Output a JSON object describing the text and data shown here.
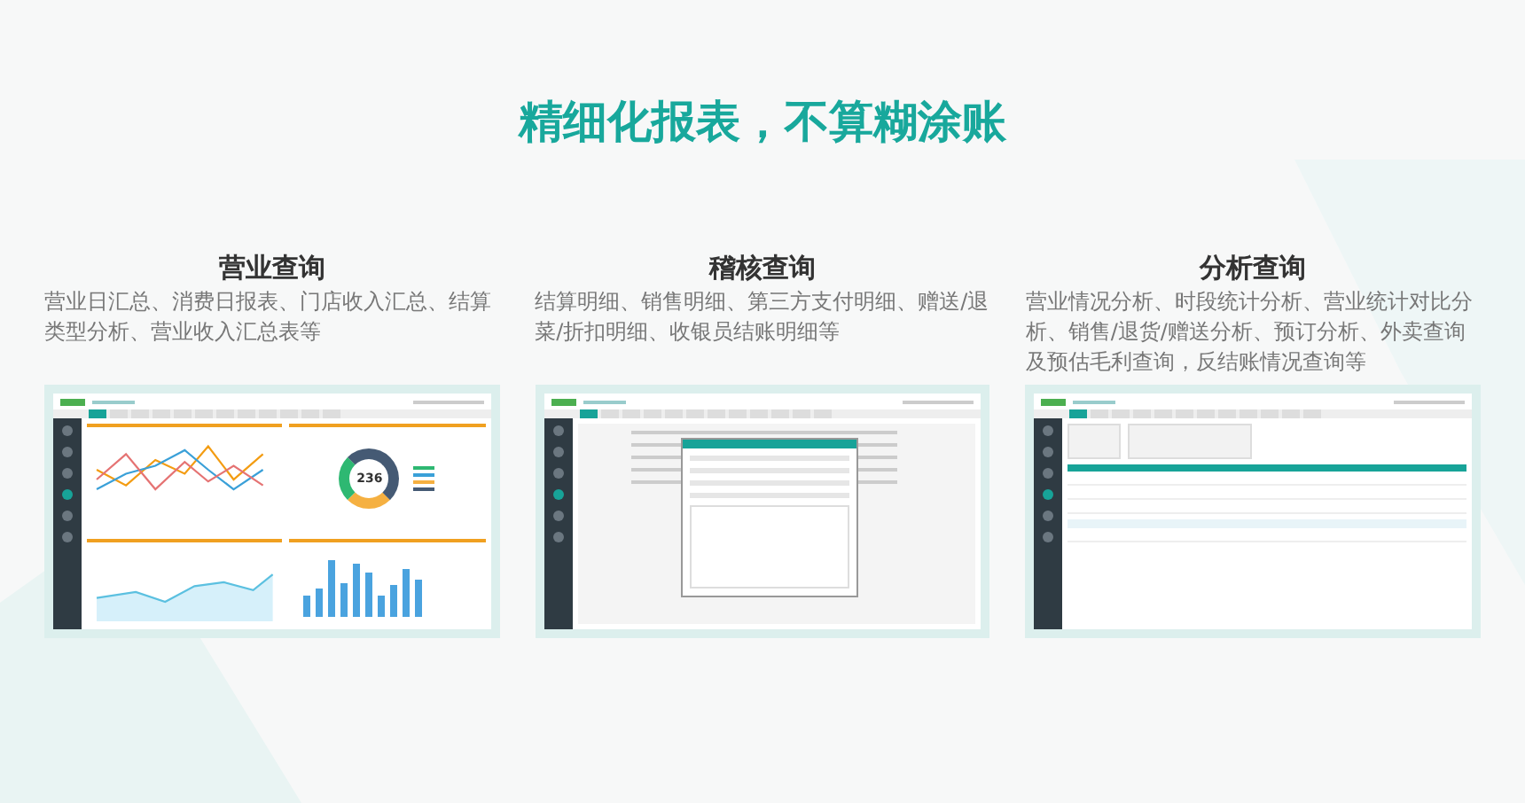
{
  "title": "精细化报表，不算糊涂账",
  "features": [
    {
      "heading": "营业查询",
      "description": "营业日汇总、消费日报表、门店收入汇总、结算类型分析、营业收入汇总表等",
      "screenshot": {
        "kind": "dashboard",
        "donut_total": "236"
      }
    },
    {
      "heading": "稽核查询",
      "description": "结算明细、销售明细、第三方支付明细、赠送/退菜/折扣明细、收银员结账明细等",
      "screenshot": {
        "kind": "dialog"
      }
    },
    {
      "heading": "分析查询",
      "description": "营业情况分析、时段统计分析、营业统计对比分析、销售/退货/赠送分析、预订分析、外卖查询及预估毛利查询，反结账情况查询等",
      "screenshot": {
        "kind": "table"
      }
    }
  ]
}
